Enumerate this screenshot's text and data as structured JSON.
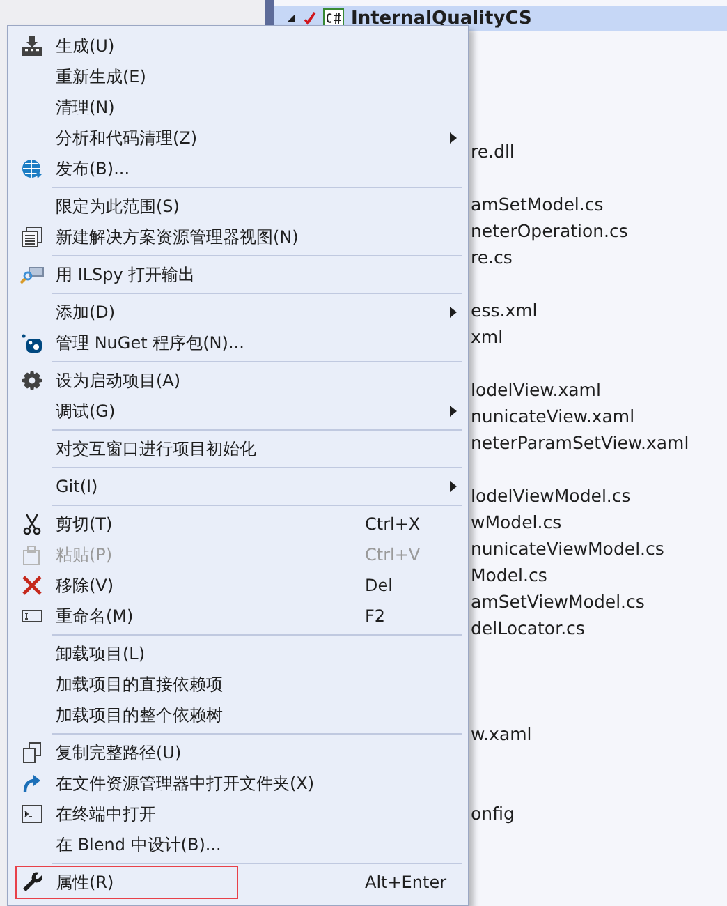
{
  "explorer": {
    "rows": [
      {
        "kind": "project",
        "text": "InternalQualityCS",
        "selected": true
      },
      {
        "kind": "covered"
      },
      {
        "kind": "covered"
      },
      {
        "kind": "covered"
      },
      {
        "kind": "covered"
      },
      {
        "kind": "file",
        "text": "re.dll"
      },
      {
        "kind": "covered"
      },
      {
        "kind": "file",
        "text": "amSetModel.cs"
      },
      {
        "kind": "file",
        "text": "neterOperation.cs"
      },
      {
        "kind": "file",
        "text": "re.cs"
      },
      {
        "kind": "covered"
      },
      {
        "kind": "file",
        "text": "ess.xml"
      },
      {
        "kind": "file",
        "text": "xml"
      },
      {
        "kind": "covered"
      },
      {
        "kind": "file",
        "text": "lodelView.xaml"
      },
      {
        "kind": "file",
        "text": "nunicateView.xaml"
      },
      {
        "kind": "file",
        "text": "neterParamSetView.xaml"
      },
      {
        "kind": "covered"
      },
      {
        "kind": "file",
        "text": "lodelViewModel.cs"
      },
      {
        "kind": "file",
        "text": "wModel.cs"
      },
      {
        "kind": "file",
        "text": "nunicateViewModel.cs"
      },
      {
        "kind": "file",
        "text": "Model.cs"
      },
      {
        "kind": "file",
        "text": "amSetViewModel.cs"
      },
      {
        "kind": "file",
        "text": "delLocator.cs"
      },
      {
        "kind": "covered"
      },
      {
        "kind": "covered"
      },
      {
        "kind": "covered"
      },
      {
        "kind": "file",
        "text": "w.xaml"
      },
      {
        "kind": "covered"
      },
      {
        "kind": "covered"
      },
      {
        "kind": "file",
        "text": "onfig"
      }
    ]
  },
  "context_menu": {
    "items": [
      {
        "kind": "item",
        "label": "生成(U)"
      },
      {
        "kind": "item",
        "label": "重新生成(E)"
      },
      {
        "kind": "item",
        "label": "清理(N)"
      },
      {
        "kind": "item",
        "label": "分析和代码清理(Z)",
        "submenu": true
      },
      {
        "kind": "item",
        "label": "发布(B)..."
      },
      {
        "kind": "separator"
      },
      {
        "kind": "item",
        "label": "限定为此范围(S)"
      },
      {
        "kind": "item",
        "label": "新建解决方案资源管理器视图(N)"
      },
      {
        "kind": "separator"
      },
      {
        "kind": "item",
        "label": "用 ILSpy 打开输出"
      },
      {
        "kind": "separator"
      },
      {
        "kind": "item",
        "label": "添加(D)",
        "submenu": true
      },
      {
        "kind": "item",
        "label": "管理 NuGet 程序包(N)..."
      },
      {
        "kind": "separator"
      },
      {
        "kind": "item",
        "label": "设为启动项目(A)"
      },
      {
        "kind": "item",
        "label": "调试(G)",
        "submenu": true
      },
      {
        "kind": "separator"
      },
      {
        "kind": "item",
        "label": "对交互窗口进行项目初始化"
      },
      {
        "kind": "separator"
      },
      {
        "kind": "item",
        "label": "Git(I)",
        "submenu": true
      },
      {
        "kind": "separator"
      },
      {
        "kind": "item",
        "label": "剪切(T)",
        "shortcut": "Ctrl+X"
      },
      {
        "kind": "item",
        "label": "粘贴(P)",
        "shortcut": "Ctrl+V",
        "disabled": true
      },
      {
        "kind": "item",
        "label": "移除(V)",
        "shortcut": "Del"
      },
      {
        "kind": "item",
        "label": "重命名(M)",
        "shortcut": "F2"
      },
      {
        "kind": "separator"
      },
      {
        "kind": "item",
        "label": "卸载项目(L)"
      },
      {
        "kind": "item",
        "label": "加载项目的直接依赖项"
      },
      {
        "kind": "item",
        "label": "加载项目的整个依赖树"
      },
      {
        "kind": "separator"
      },
      {
        "kind": "item",
        "label": "复制完整路径(U)"
      },
      {
        "kind": "item",
        "label": "在文件资源管理器中打开文件夹(X)"
      },
      {
        "kind": "item",
        "label": "在终端中打开"
      },
      {
        "kind": "item",
        "label": "在 Blend 中设计(B)..."
      },
      {
        "kind": "separator"
      },
      {
        "kind": "item",
        "label": "属性(R)",
        "shortcut": "Alt+Enter",
        "outlined": true
      }
    ]
  }
}
